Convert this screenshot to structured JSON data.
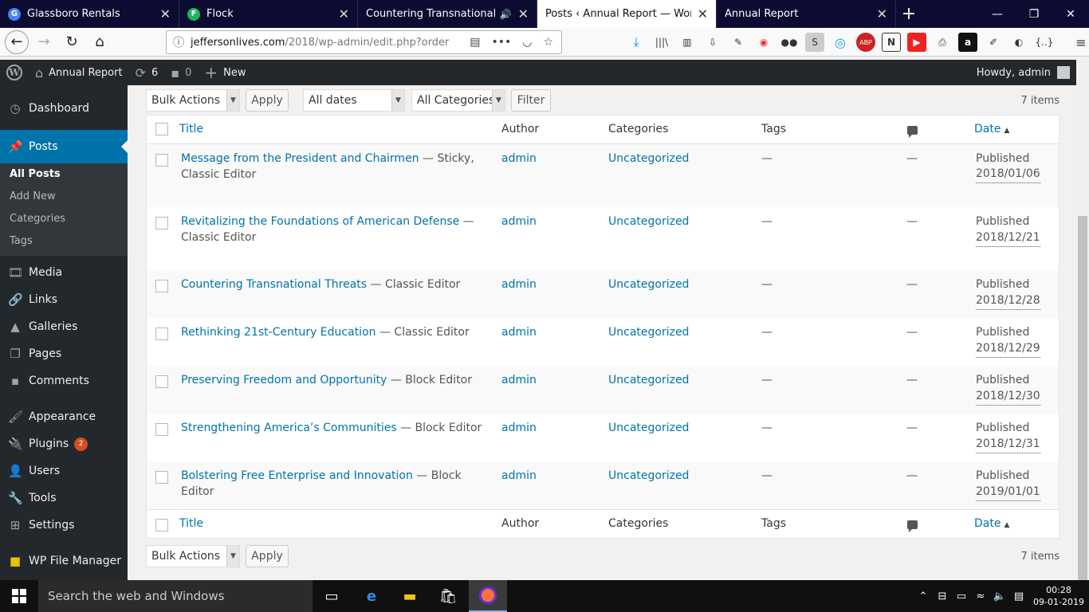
{
  "browser": {
    "tabs": [
      {
        "title": "Glassboro Rentals",
        "icon": "google-icon",
        "active": false
      },
      {
        "title": "Flock",
        "icon": "flock-icon",
        "active": false
      },
      {
        "title": "Countering Transnational Threa",
        "icon": "audio-icon",
        "active": false
      },
      {
        "title": "Posts ‹ Annual Report — WordPress",
        "icon": "",
        "active": true
      },
      {
        "title": "Annual Report",
        "icon": "",
        "active": false
      }
    ],
    "url_domain": "jeffersonlives.com",
    "url_path": "/2018/wp-admin/edit.php?order",
    "more_label": "•••"
  },
  "adminbar": {
    "site_name": "Annual Report",
    "updates_count": "6",
    "comments_count": "0",
    "new_label": "New",
    "howdy": "Howdy, admin"
  },
  "sidebar": {
    "items": [
      {
        "label": "Dashboard",
        "icon": "dashboard-icon"
      },
      {
        "label": "Posts",
        "icon": "pin-icon"
      },
      {
        "label": "Media",
        "icon": "media-icon"
      },
      {
        "label": "Links",
        "icon": "link-icon"
      },
      {
        "label": "Galleries",
        "icon": "gallery-icon"
      },
      {
        "label": "Pages",
        "icon": "pages-icon"
      },
      {
        "label": "Comments",
        "icon": "comment-icon"
      },
      {
        "label": "Appearance",
        "icon": "brush-icon"
      },
      {
        "label": "Plugins",
        "icon": "plugin-icon",
        "badge": "2"
      },
      {
        "label": "Users",
        "icon": "user-icon"
      },
      {
        "label": "Tools",
        "icon": "wrench-icon"
      },
      {
        "label": "Settings",
        "icon": "settings-icon"
      },
      {
        "label": "WP File Manager",
        "icon": "folder-icon"
      }
    ],
    "submenu": [
      "All Posts",
      "Add New",
      "Categories",
      "Tags"
    ]
  },
  "filters": {
    "bulk_actions": "Bulk Actions",
    "apply": "Apply",
    "all_dates": "All dates",
    "all_categories": "All Categories",
    "filter": "Filter",
    "items_count": "7 items"
  },
  "table": {
    "headers": {
      "title": "Title",
      "author": "Author",
      "categories": "Categories",
      "tags": "Tags",
      "date": "Date"
    },
    "rows": [
      {
        "title": "Message from the President and Chairmen",
        "state": " — Sticky, Classic Editor",
        "author": "admin",
        "category": "Uncategorized",
        "tags": "—",
        "comments": "—",
        "status": "Published",
        "date": "2018/01/06"
      },
      {
        "title": "Revitalizing the Foundations of American Defense",
        "state": " — Classic Editor",
        "author": "admin",
        "category": "Uncategorized",
        "tags": "—",
        "comments": "—",
        "status": "Published",
        "date": "2018/12/21"
      },
      {
        "title": "Countering Transnational Threats",
        "state": " — Classic Editor",
        "author": "admin",
        "category": "Uncategorized",
        "tags": "—",
        "comments": "—",
        "status": "Published",
        "date": "2018/12/28"
      },
      {
        "title": "Rethinking 21st-Century Education",
        "state": " — Classic Editor",
        "author": "admin",
        "category": "Uncategorized",
        "tags": "—",
        "comments": "—",
        "status": "Published",
        "date": "2018/12/29"
      },
      {
        "title": "Preserving Freedom and Opportunity",
        "state": " — Block Editor",
        "author": "admin",
        "category": "Uncategorized",
        "tags": "—",
        "comments": "—",
        "status": "Published",
        "date": "2018/12/30"
      },
      {
        "title": "Strengthening America’s Communities",
        "state": " — Block Editor",
        "author": "admin",
        "category": "Uncategorized",
        "tags": "—",
        "comments": "—",
        "status": "Published",
        "date": "2018/12/31"
      },
      {
        "title": "Bolstering Free Enterprise and Innovation",
        "state": " — Block Editor",
        "author": "admin",
        "category": "Uncategorized",
        "tags": "—",
        "comments": "—",
        "status": "Published",
        "date": "2019/01/01"
      }
    ]
  },
  "taskbar": {
    "search_placeholder": "Search the web and Windows",
    "time": "00:28",
    "date": "09-01-2019"
  }
}
